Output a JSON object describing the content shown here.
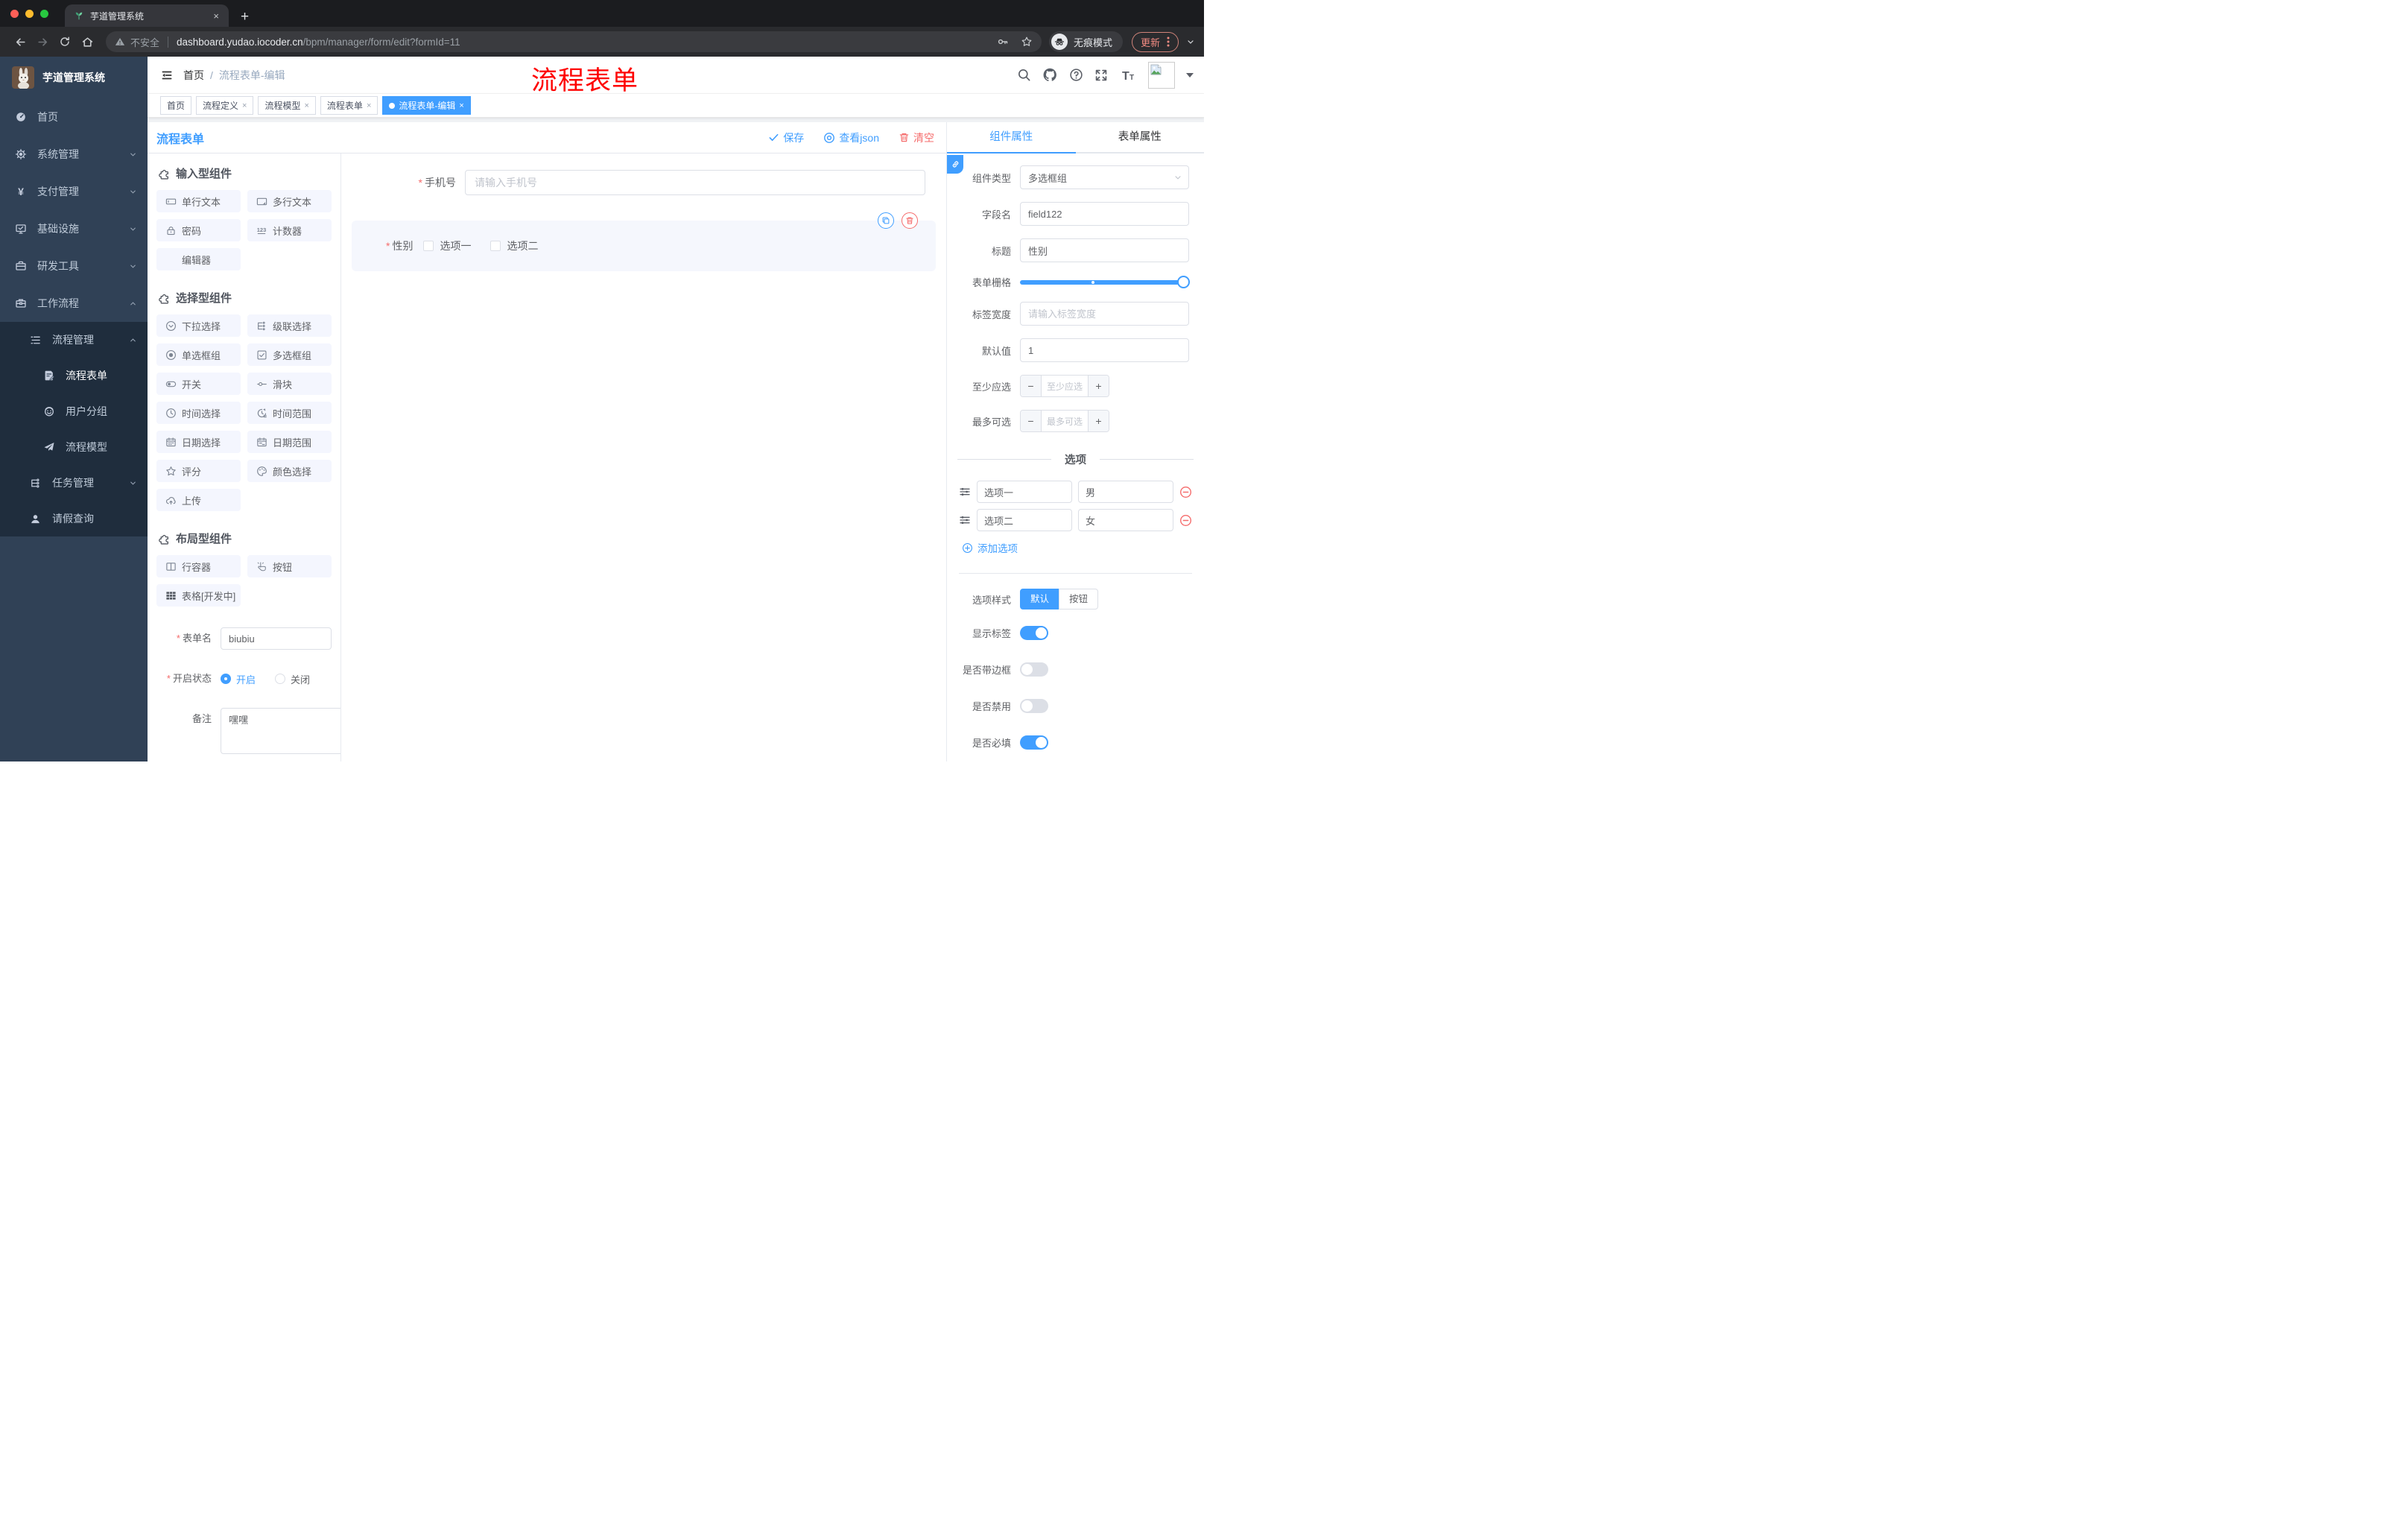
{
  "browser": {
    "tab_title": "芋道管理系统",
    "tab_close": "×",
    "new_tab_button": "+",
    "security_label": "不安全",
    "url_host": "dashboard.yudao.iocoder.cn",
    "url_path": "/bpm/manager/form/edit?formId=11",
    "incognito_label": "无痕模式",
    "update_button": "更新"
  },
  "sidebar": {
    "app_title": "芋道管理系统",
    "items": [
      {
        "label": "首页",
        "icon": "dashboard-icon",
        "level": 1
      },
      {
        "label": "系统管理",
        "icon": "gear-icon",
        "level": 1,
        "chevron": "down"
      },
      {
        "label": "支付管理",
        "icon": "yen-icon",
        "level": 1,
        "chevron": "down"
      },
      {
        "label": "基础设施",
        "icon": "monitor-icon",
        "level": 1,
        "chevron": "down"
      },
      {
        "label": "研发工具",
        "icon": "toolbox-icon",
        "level": 1,
        "chevron": "down"
      },
      {
        "label": "工作流程",
        "icon": "briefcase-icon",
        "level": 1,
        "chevron": "up"
      },
      {
        "label": "流程管理",
        "icon": "list-tree-icon",
        "level": 2,
        "chevron": "up"
      },
      {
        "label": "流程表单",
        "icon": "form-edit-icon",
        "level": 3
      },
      {
        "label": "用户分组",
        "icon": "user-group-icon",
        "level": 3
      },
      {
        "label": "流程模型",
        "icon": "paper-plane-icon",
        "level": 3
      },
      {
        "label": "任务管理",
        "icon": "org-tree-icon",
        "level": 2,
        "chevron": "down"
      },
      {
        "label": "请假查询",
        "icon": "person-icon",
        "level": 2
      }
    ]
  },
  "header": {
    "breadcrumb": {
      "home": "首页",
      "separator": "/",
      "current": "流程表单-编辑"
    },
    "watermark": "流程表单",
    "icons": [
      "search-icon",
      "github-icon",
      "help-icon",
      "fullscreen-icon",
      "font-size-icon",
      "avatar"
    ]
  },
  "tagbar": {
    "close_glyph": "×",
    "tags": [
      {
        "label": "首页",
        "closable": false,
        "active": false
      },
      {
        "label": "流程定义",
        "closable": true,
        "active": false
      },
      {
        "label": "流程模型",
        "closable": true,
        "active": false
      },
      {
        "label": "流程表单",
        "closable": true,
        "active": false
      },
      {
        "label": "流程表单-编辑",
        "closable": true,
        "active": true
      }
    ]
  },
  "designer": {
    "title": "流程表单",
    "save_button": "保存",
    "view_json_button": "查看json",
    "clear_button": "清空"
  },
  "palette": {
    "sections": [
      {
        "title": "输入型组件",
        "items": [
          "单行文本",
          "多行文本",
          "密码",
          "计数器",
          "编辑器"
        ],
        "icons": [
          "input-icon",
          "textarea-icon",
          "lock-icon",
          "counter-icon",
          "none"
        ]
      },
      {
        "title": "选择型组件",
        "items": [
          "下拉选择",
          "级联选择",
          "单选框组",
          "多选框组",
          "开关",
          "滑块",
          "时间选择",
          "时间范围",
          "日期选择",
          "日期范围",
          "评分",
          "颜色选择",
          "上传"
        ],
        "icons": [
          "select-icon",
          "cascader-icon",
          "radio-icon",
          "checkbox-icon",
          "switch-icon",
          "slider-icon",
          "time-icon",
          "time-range-icon",
          "date-icon",
          "date-range-icon",
          "star-icon",
          "palette-icon",
          "upload-icon"
        ]
      },
      {
        "title": "布局型组件",
        "items": [
          "行容器",
          "按钮",
          "表格[开发中]"
        ],
        "icons": [
          "row-container-icon",
          "button-click-icon",
          "table-icon"
        ]
      }
    ]
  },
  "form_config": {
    "name": {
      "label": "表单名",
      "value": "biubiu",
      "required": true
    },
    "status": {
      "label": "开启状态",
      "required": true,
      "options": [
        "开启",
        "关闭"
      ],
      "selected": "开启"
    },
    "remark": {
      "label": "备注",
      "value": "嘿嘿"
    }
  },
  "canvas": {
    "phone_field": {
      "label": "手机号",
      "placeholder": "请输入手机号",
      "required": true
    },
    "gender_field": {
      "label": "性别",
      "required": true,
      "options": [
        "选项一",
        "选项二"
      ],
      "selected": true
    }
  },
  "panel": {
    "tabs": [
      "组件属性",
      "表单属性"
    ],
    "active_tab": "组件属性",
    "component_type": {
      "label": "组件类型",
      "value": "多选框组"
    },
    "field_name": {
      "label": "字段名",
      "value": "field122"
    },
    "title_field": {
      "label": "标题",
      "value": "性别"
    },
    "form_grid": {
      "label": "表单栅格"
    },
    "label_width": {
      "label": "标签宽度",
      "placeholder": "请输入标签宽度"
    },
    "default_value": {
      "label": "默认值",
      "value": "1"
    },
    "min_select": {
      "label": "至少应选",
      "placeholder": "至少应选"
    },
    "max_select": {
      "label": "最多可选",
      "placeholder": "最多可选"
    },
    "options_section": {
      "title": "选项",
      "rows": [
        {
          "label": "选项一",
          "value": "男"
        },
        {
          "label": "选项二",
          "value": "女"
        }
      ],
      "add_label": "添加选项"
    },
    "option_style": {
      "label": "选项样式",
      "options": [
        "默认",
        "按钮"
      ],
      "selected": "默认"
    },
    "switches": [
      {
        "label": "显示标签",
        "on": true
      },
      {
        "label": "是否带边框",
        "on": false
      },
      {
        "label": "是否禁用",
        "on": false
      },
      {
        "label": "是否必填",
        "on": true
      }
    ]
  },
  "colors": {
    "primary": "#409EFF",
    "danger": "#F56C6C",
    "watermark_red": "#FE0100",
    "sidebar_bg": "#304156",
    "submenu_bg": "#1F2D3D"
  }
}
